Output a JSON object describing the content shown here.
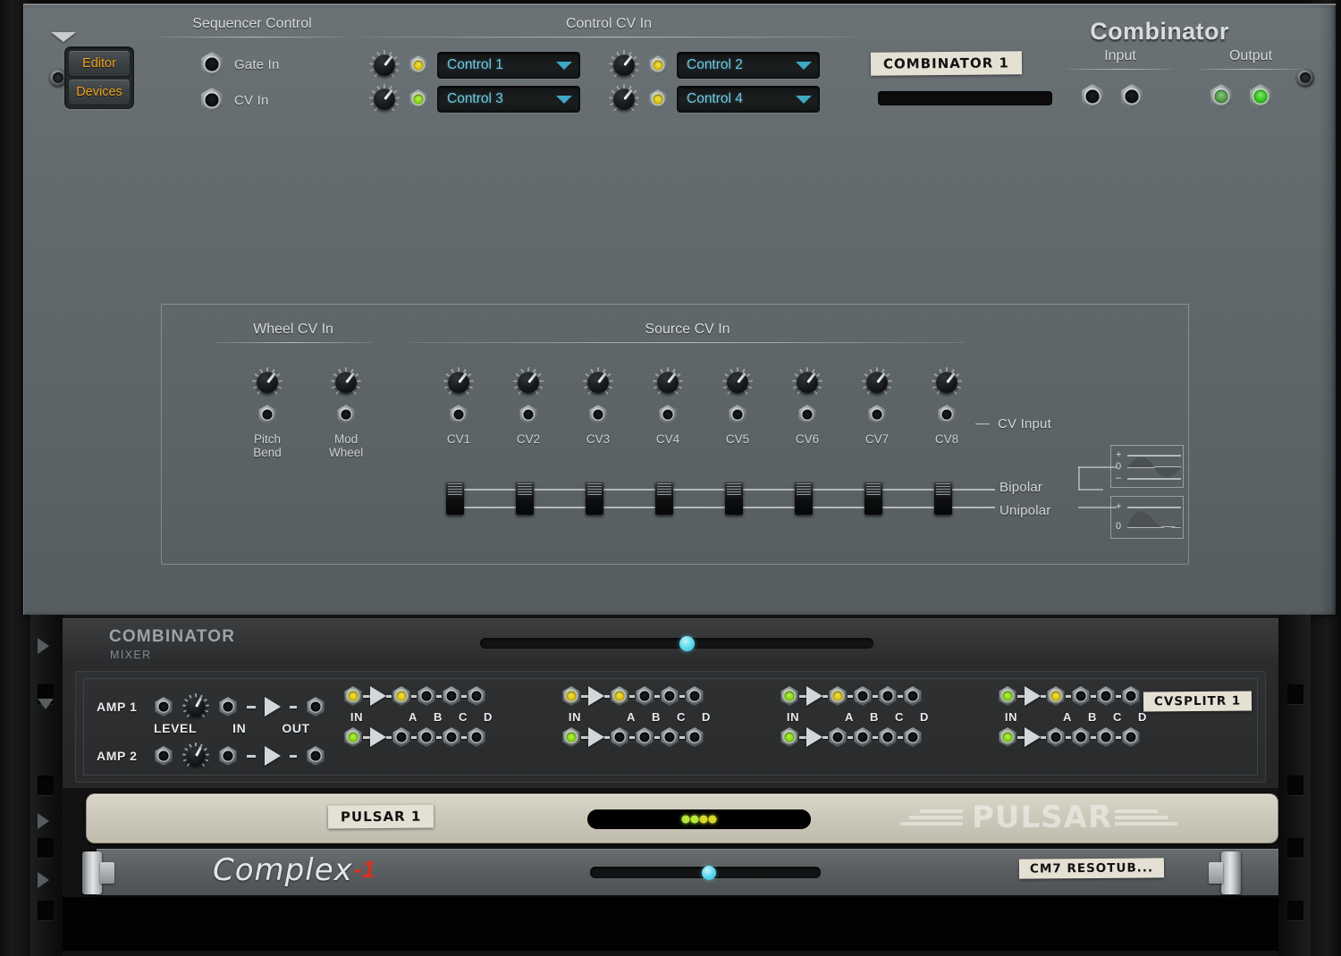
{
  "window": {
    "title": "Combinator"
  },
  "top_panel": {
    "fold_arrow": "triangle-down",
    "buttons": {
      "editor": "Editor",
      "devices": "Devices"
    },
    "sequencer_control": {
      "title": "Sequencer Control",
      "jacks": [
        {
          "label": "Gate In",
          "name": "gate-in"
        },
        {
          "label": "CV In",
          "name": "cv-in"
        }
      ]
    },
    "control_cv_in": {
      "title": "Control CV In",
      "rows": [
        {
          "select": "Control 1",
          "name": "control-1"
        },
        {
          "select": "Control 2",
          "name": "control-2"
        },
        {
          "select": "Control 3",
          "name": "control-3"
        },
        {
          "select": "Control 4",
          "name": "control-4"
        }
      ]
    },
    "brand": "Combinator",
    "patch_name": "COMBINATOR 1",
    "input": {
      "label": "Input"
    },
    "output": {
      "label": "Output"
    }
  },
  "cv_panel": {
    "wheel_cv_in": {
      "title": "Wheel CV In",
      "items": [
        {
          "line1": "Pitch",
          "line2": "Bend",
          "name": "pitch-bend"
        },
        {
          "line1": "Mod",
          "line2": "Wheel",
          "name": "mod-wheel"
        }
      ]
    },
    "source_cv_in": {
      "title": "Source CV In",
      "items": [
        "CV1",
        "CV2",
        "CV3",
        "CV4",
        "CV5",
        "CV6",
        "CV7",
        "CV8"
      ]
    },
    "legend": {
      "cv_input": "CV Input",
      "bipolar": "Bipolar",
      "unipolar": "Unipolar",
      "wave_marks_bipolar": [
        "+",
        "0",
        "–"
      ],
      "wave_marks_unipolar": [
        "+",
        "0"
      ]
    }
  },
  "rack": {
    "combinator_device": {
      "title": "COMBINATOR",
      "subtitle": "MIXER",
      "mixer": {
        "amps": [
          {
            "label": "AMP 1",
            "name": "amp-1"
          },
          {
            "label": "AMP 2",
            "name": "amp-2"
          }
        ],
        "level_label": "LEVEL",
        "in_label": "IN",
        "out_label": "OUT"
      },
      "splitters": {
        "in_label": "IN",
        "outputs": [
          "A",
          "B",
          "C",
          "D"
        ],
        "groups": 4,
        "patch_name": "CVSPLITR 1"
      }
    },
    "pulsar_device": {
      "patch_name": "PULSAR 1",
      "brand": "PULSAR",
      "led_colors": [
        "#b6e83a",
        "#b6e83a",
        "#d8d82a",
        "#d8d82a"
      ]
    },
    "complex_device": {
      "brand": "Complex",
      "brand_suffix": "-1",
      "patch_name": "CM7 RESOTUB..."
    }
  },
  "colors": {
    "panel": "#636a6e",
    "accent_cyan": "#6fc9e0",
    "accent_amber": "#f0a018",
    "led_green": "#34c21d",
    "led_yellow": "#d8c312",
    "complex_red": "#d8301f"
  }
}
